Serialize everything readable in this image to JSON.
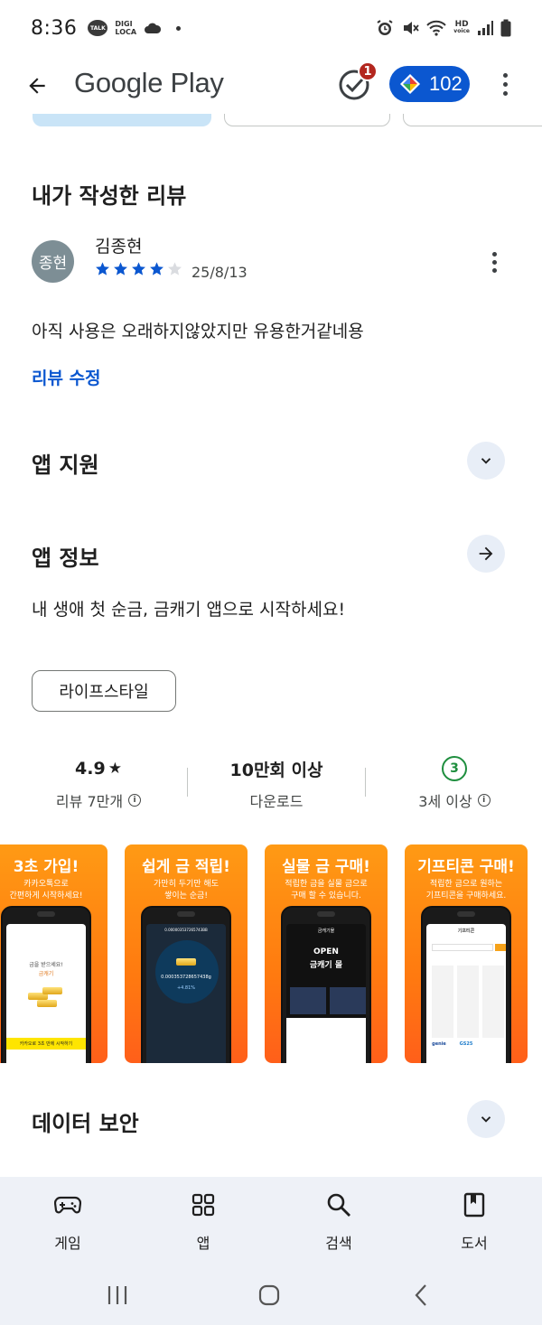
{
  "status_bar": {
    "time": "8:36",
    "talk_label": "TALK",
    "digi_label_1": "DIGI",
    "digi_label_2": "LOCA",
    "hd_label_1": "HD",
    "hd_label_2": "voice"
  },
  "app_bar": {
    "title": "Google Play",
    "notification_count": "1",
    "points": "102"
  },
  "my_review": {
    "section_title": "내가 작성한 리뷰",
    "avatar_text": "종현",
    "reviewer_name": "김종현",
    "rating": 4,
    "max_rating": 5,
    "date": "25/8/13",
    "text": "아직 사용은 오래하지않았지만 유용한거같네용",
    "edit_label": "리뷰 수정"
  },
  "app_support": {
    "title": "앱 지원"
  },
  "app_info": {
    "title": "앱 정보",
    "description": "내 생애 첫 순금, 금캐기 앱으로 시작하세요!",
    "category": "라이프스타일"
  },
  "stats": {
    "rating_value": "4.9",
    "rating_star": "★",
    "reviews_label": "리뷰 7만개",
    "downloads_value": "10만회 이상",
    "downloads_label": "다운로드",
    "age_value": "3",
    "age_label": "3세 이상",
    "info_glyph": "i"
  },
  "screenshots": [
    {
      "title": "3초 가입!",
      "sub_1": "카카오톡으로",
      "sub_2": "간편하게 시작하세요!",
      "screen_1": "금을 받으세요!",
      "screen_2": "금캐기",
      "screen_3": "카카오로 3초 만에 시작하기"
    },
    {
      "title": "쉽게 금 적립!",
      "sub_1": "가만히 두기만 해도",
      "sub_2": "쌓이는 순금!",
      "screen_1": "0.000003537265743BB",
      "screen_2": "0.000353728657438g",
      "screen_3": "+4.81%"
    },
    {
      "title": "실물 금 구매!",
      "sub_1": "적립한 금을 실물 금으로",
      "sub_2": "구매 할 수 있습니다.",
      "screen_1": "금캐기몰",
      "screen_2": "OPEN",
      "screen_3": "금캐기 몰"
    },
    {
      "title": "기프티콘 구매!",
      "sub_1": "적립한 금으로 원하는",
      "sub_2": "기프티콘을 구매하세요.",
      "screen_1": "기프티콘",
      "screen_2": "genie",
      "screen_3": "GS25"
    }
  ],
  "data_safety": {
    "title": "데이터 보안"
  },
  "bottom_nav": {
    "items": [
      {
        "label": "게임",
        "icon": "gamepad-icon"
      },
      {
        "label": "앱",
        "icon": "apps-grid-icon"
      },
      {
        "label": "검색",
        "icon": "search-icon"
      },
      {
        "label": "도서",
        "icon": "book-icon"
      }
    ]
  },
  "colors": {
    "accent_blue": "#0b57d0",
    "badge_red": "#b3261e",
    "age_green": "#1e8e3e",
    "screenshot_orange": "#ff8a12"
  }
}
